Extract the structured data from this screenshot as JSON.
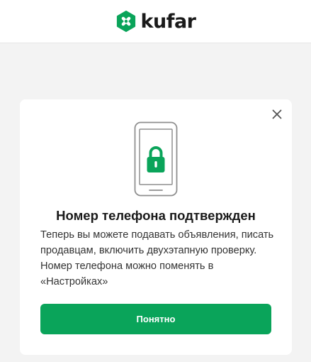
{
  "header": {
    "logo_text": "kufar",
    "logo_icon": "kufar-logo-icon"
  },
  "dialog": {
    "title": "Номер телефона подтвержден",
    "description": "Теперь вы можете подавать объявления, писать продавцам, включить двухэтапную проверку. Номер телефона можно поменять в «Настройках»",
    "button_label": "Понятно",
    "close_icon": "close-icon",
    "illustration": "phone-lock-icon"
  },
  "colors": {
    "brand": "#0aa45a",
    "background": "#f3f3f3",
    "phone_outline": "#8f8f8f"
  }
}
